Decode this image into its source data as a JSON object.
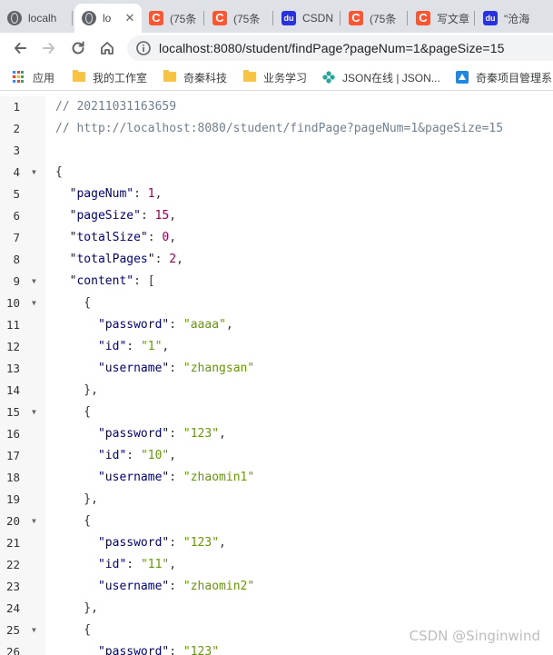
{
  "tabs": [
    {
      "title": "localh",
      "favicon": "globe-icon",
      "active": false
    },
    {
      "title": "lo",
      "favicon": "globe-icon",
      "active": true
    },
    {
      "title": "(75条",
      "favicon": "csdn-icon",
      "active": false
    },
    {
      "title": "(75条",
      "favicon": "csdn-icon",
      "active": false
    },
    {
      "title": "CSDN",
      "favicon": "baidu-icon",
      "active": false
    },
    {
      "title": "(75条",
      "favicon": "csdn-icon",
      "active": false
    },
    {
      "title": "写文章",
      "favicon": "csdn-icon",
      "active": false
    },
    {
      "title": "\"沧海",
      "favicon": "baidu-icon",
      "active": false
    }
  ],
  "address_bar": {
    "url": "localhost:8080/student/findPage?pageNum=1&pageSize=15"
  },
  "bookmarks": [
    {
      "label": "应用",
      "icon": "apps-icon"
    },
    {
      "label": "我的工作室",
      "icon": "folder-icon"
    },
    {
      "label": "奇秦科技",
      "icon": "folder-icon"
    },
    {
      "label": "业务学习",
      "icon": "folder-icon"
    },
    {
      "label": "JSON在线 | JSON...",
      "icon": "json-online-icon"
    },
    {
      "label": "奇秦项目管理系",
      "icon": "app-favicon-icon"
    }
  ],
  "code_lines": [
    {
      "n": "1",
      "fold": false,
      "tokens": [
        [
          "c",
          "// 20211031163659"
        ]
      ]
    },
    {
      "n": "2",
      "fold": false,
      "tokens": [
        [
          "c",
          "// http://localhost:8080/student/findPage?pageNum=1&pageSize=15"
        ]
      ]
    },
    {
      "n": "3",
      "fold": false,
      "tokens": []
    },
    {
      "n": "4",
      "fold": true,
      "tokens": [
        [
          "p",
          "{"
        ]
      ]
    },
    {
      "n": "5",
      "fold": false,
      "tokens": [
        [
          "p",
          "  "
        ],
        [
          "k",
          "\"pageNum\""
        ],
        [
          "p",
          ": "
        ],
        [
          "n",
          "1"
        ],
        [
          "p",
          ","
        ]
      ]
    },
    {
      "n": "6",
      "fold": false,
      "tokens": [
        [
          "p",
          "  "
        ],
        [
          "k",
          "\"pageSize\""
        ],
        [
          "p",
          ": "
        ],
        [
          "n",
          "15"
        ],
        [
          "p",
          ","
        ]
      ]
    },
    {
      "n": "7",
      "fold": false,
      "tokens": [
        [
          "p",
          "  "
        ],
        [
          "k",
          "\"totalSize\""
        ],
        [
          "p",
          ": "
        ],
        [
          "n",
          "0"
        ],
        [
          "p",
          ","
        ]
      ]
    },
    {
      "n": "8",
      "fold": false,
      "tokens": [
        [
          "p",
          "  "
        ],
        [
          "k",
          "\"totalPages\""
        ],
        [
          "p",
          ": "
        ],
        [
          "n",
          "2"
        ],
        [
          "p",
          ","
        ]
      ]
    },
    {
      "n": "9",
      "fold": true,
      "tokens": [
        [
          "p",
          "  "
        ],
        [
          "k",
          "\"content\""
        ],
        [
          "p",
          ": ["
        ]
      ]
    },
    {
      "n": "10",
      "fold": true,
      "tokens": [
        [
          "p",
          "    {"
        ]
      ]
    },
    {
      "n": "11",
      "fold": false,
      "tokens": [
        [
          "p",
          "      "
        ],
        [
          "k",
          "\"password\""
        ],
        [
          "p",
          ": "
        ],
        [
          "s",
          "\"aaaa\""
        ],
        [
          "p",
          ","
        ]
      ]
    },
    {
      "n": "12",
      "fold": false,
      "tokens": [
        [
          "p",
          "      "
        ],
        [
          "k",
          "\"id\""
        ],
        [
          "p",
          ": "
        ],
        [
          "s",
          "\"1\""
        ],
        [
          "p",
          ","
        ]
      ]
    },
    {
      "n": "13",
      "fold": false,
      "tokens": [
        [
          "p",
          "      "
        ],
        [
          "k",
          "\"username\""
        ],
        [
          "p",
          ": "
        ],
        [
          "s",
          "\"zhangsan\""
        ]
      ]
    },
    {
      "n": "14",
      "fold": false,
      "tokens": [
        [
          "p",
          "    },"
        ]
      ]
    },
    {
      "n": "15",
      "fold": true,
      "tokens": [
        [
          "p",
          "    {"
        ]
      ]
    },
    {
      "n": "16",
      "fold": false,
      "tokens": [
        [
          "p",
          "      "
        ],
        [
          "k",
          "\"password\""
        ],
        [
          "p",
          ": "
        ],
        [
          "s",
          "\"123\""
        ],
        [
          "p",
          ","
        ]
      ]
    },
    {
      "n": "17",
      "fold": false,
      "tokens": [
        [
          "p",
          "      "
        ],
        [
          "k",
          "\"id\""
        ],
        [
          "p",
          ": "
        ],
        [
          "s",
          "\"10\""
        ],
        [
          "p",
          ","
        ]
      ]
    },
    {
      "n": "18",
      "fold": false,
      "tokens": [
        [
          "p",
          "      "
        ],
        [
          "k",
          "\"username\""
        ],
        [
          "p",
          ": "
        ],
        [
          "s",
          "\"zhaomin1\""
        ]
      ]
    },
    {
      "n": "19",
      "fold": false,
      "tokens": [
        [
          "p",
          "    },"
        ]
      ]
    },
    {
      "n": "20",
      "fold": true,
      "tokens": [
        [
          "p",
          "    {"
        ]
      ]
    },
    {
      "n": "21",
      "fold": false,
      "tokens": [
        [
          "p",
          "      "
        ],
        [
          "k",
          "\"password\""
        ],
        [
          "p",
          ": "
        ],
        [
          "s",
          "\"123\""
        ],
        [
          "p",
          ","
        ]
      ]
    },
    {
      "n": "22",
      "fold": false,
      "tokens": [
        [
          "p",
          "      "
        ],
        [
          "k",
          "\"id\""
        ],
        [
          "p",
          ": "
        ],
        [
          "s",
          "\"11\""
        ],
        [
          "p",
          ","
        ]
      ]
    },
    {
      "n": "23",
      "fold": false,
      "tokens": [
        [
          "p",
          "      "
        ],
        [
          "k",
          "\"username\""
        ],
        [
          "p",
          ": "
        ],
        [
          "s",
          "\"zhaomin2\""
        ]
      ]
    },
    {
      "n": "24",
      "fold": false,
      "tokens": [
        [
          "p",
          "    },"
        ]
      ]
    },
    {
      "n": "25",
      "fold": true,
      "tokens": [
        [
          "p",
          "    {"
        ]
      ]
    },
    {
      "n": "26",
      "fold": false,
      "tokens": [
        [
          "p",
          "      "
        ],
        [
          "k",
          "\"password\""
        ],
        [
          "p",
          ": "
        ],
        [
          "s",
          "\"123\""
        ]
      ]
    }
  ],
  "watermark": "CSDN @Singinwind",
  "colors": {
    "json_key": "#000080",
    "json_number": "#990055",
    "json_string": "#669900",
    "comment": "#708090",
    "tabstrip_bg": "#dee1e6"
  }
}
